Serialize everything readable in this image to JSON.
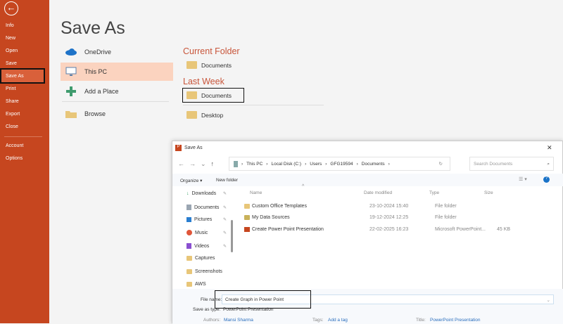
{
  "sidebar": {
    "back": "←",
    "items": [
      "Info",
      "New",
      "Open",
      "Save",
      "Save As",
      "Print",
      "Share",
      "Export",
      "Close"
    ],
    "bottom": [
      "Account",
      "Options"
    ],
    "active": "Save As"
  },
  "main": {
    "title": "Save As",
    "locations": [
      {
        "label": "OneDrive",
        "icon": "cloud-icon"
      },
      {
        "label": "This PC",
        "icon": "computer-icon"
      },
      {
        "label": "Add a Place",
        "icon": "plus-icon"
      },
      {
        "label": "Browse",
        "icon": "folder-open-icon"
      }
    ],
    "current_folder": {
      "heading": "Current Folder",
      "items": [
        "Documents"
      ]
    },
    "last_week": {
      "heading": "Last Week",
      "items": [
        "Documents",
        "Desktop"
      ]
    }
  },
  "dialog": {
    "title": "Save As",
    "close": "✕",
    "breadcrumb": [
      "This PC",
      "Local Disk (C:)",
      "Users",
      "GFG19594",
      "Documents"
    ],
    "search_placeholder": "Search Documents",
    "organize": "Organize ▾",
    "new_folder": "New folder",
    "nav": [
      {
        "label": "Downloads",
        "pinned": true
      },
      {
        "label": "Documents",
        "pinned": true
      },
      {
        "label": "Pictures",
        "pinned": true
      },
      {
        "label": "Music",
        "pinned": true
      },
      {
        "label": "Videos",
        "pinned": true
      },
      {
        "label": "Captures"
      },
      {
        "label": "Screenshots"
      },
      {
        "label": "AWS"
      }
    ],
    "columns": [
      "Name",
      "Date modified",
      "Type",
      "Size"
    ],
    "files": [
      {
        "name": "Custom Office Templates",
        "date": "23-10-2024 15:40",
        "type": "File folder",
        "size": ""
      },
      {
        "name": "My Data Sources",
        "date": "19-12-2024 12:25",
        "type": "File folder",
        "size": ""
      },
      {
        "name": "Create Power Point Presentation",
        "date": "22-02-2025 16:23",
        "type": "Microsoft PowerPoint...",
        "size": "45 KB"
      }
    ],
    "file_name_label": "File name:",
    "file_name": "Create Graph in Power Point",
    "save_type_label": "Save as type:",
    "save_type": "PowerPoint Presentation",
    "authors_label": "Authors:",
    "authors": "Mansi Sharma",
    "tags_label": "Tags:",
    "tags": "Add a tag",
    "title_label": "Title:",
    "title_value": "PowerPoint Presentation"
  },
  "colors": {
    "sidebar": "#c6461f",
    "accent": "#c8553a",
    "selected": "#fbd3bf"
  }
}
